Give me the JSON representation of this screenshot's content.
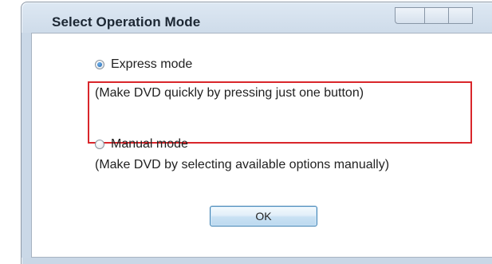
{
  "dialog": {
    "title": "Select Operation Mode"
  },
  "options": [
    {
      "label": "Express mode",
      "description": "(Make DVD quickly by pressing just one button)",
      "selected": true,
      "highlighted": true
    },
    {
      "label": "Manual mode",
      "description": "(Make DVD by selecting available options manually)",
      "selected": false,
      "highlighted": false
    }
  ],
  "buttons": {
    "ok_label": "OK"
  },
  "colors": {
    "highlight_border": "#d9262b",
    "titlebar": "#d6e2ee",
    "button_border": "#3c7fb1"
  }
}
